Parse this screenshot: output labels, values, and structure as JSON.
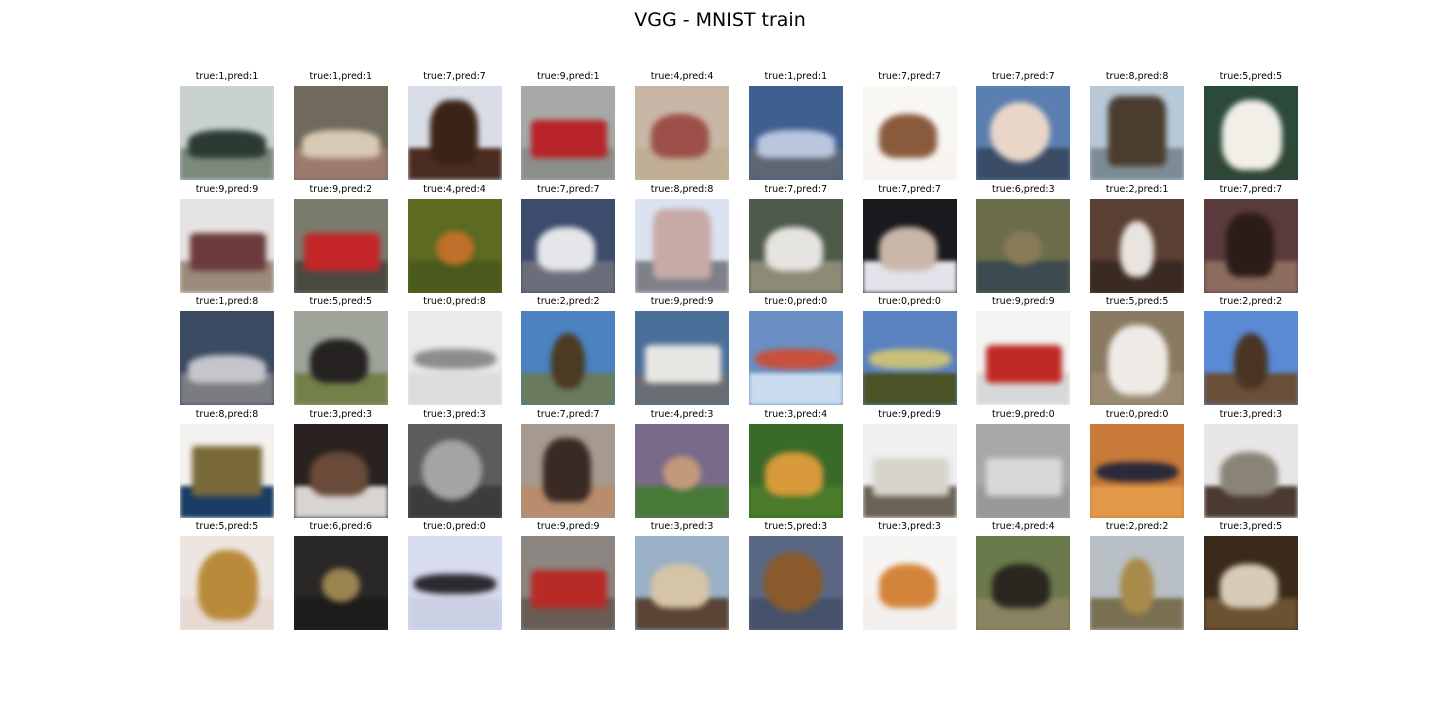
{
  "figure": {
    "title": "VGG - MNIST train"
  },
  "samples": [
    {
      "label": "true:1,pred:1",
      "content": "car",
      "bg": "#c9d2cf",
      "ground": "#7c8a7e",
      "subject": "#2c3a34",
      "shape": "car"
    },
    {
      "label": "true:1,pred:1",
      "content": "car",
      "bg": "#6f6a5c",
      "ground": "#9b7b6e",
      "subject": "#d8c9b4",
      "shape": "car"
    },
    {
      "label": "true:7,pred:7",
      "content": "horse",
      "bg": "#d9dde7",
      "ground": "#4a2c22",
      "subject": "#3a2417",
      "shape": "rider"
    },
    {
      "label": "true:9,pred:1",
      "content": "truck",
      "bg": "#a7a9a6",
      "ground": "#8b8f88",
      "subject": "#b8232a",
      "shape": "truck"
    },
    {
      "label": "true:4,pred:4",
      "content": "deer",
      "bg": "#c8b7a6",
      "ground": "#bfae93",
      "subject": "#9b4f48",
      "shape": "animal"
    },
    {
      "label": "true:1,pred:1",
      "content": "car",
      "bg": "#3e5f8f",
      "ground": "#5d6672",
      "subject": "#b9c6de",
      "shape": "car"
    },
    {
      "label": "true:7,pred:7",
      "content": "horse",
      "bg": "#f9f7f4",
      "ground": "#f7f3ef",
      "subject": "#8a5a3c",
      "shape": "animal"
    },
    {
      "label": "true:7,pred:7",
      "content": "horse",
      "bg": "#5b7fb0",
      "ground": "#3a4c66",
      "subject": "#e9d6c9",
      "shape": "head"
    },
    {
      "label": "true:8,pred:8",
      "content": "ship",
      "bg": "#b7c8d7",
      "ground": "#7d8b95",
      "subject": "#4a3c2e",
      "shape": "ship"
    },
    {
      "label": "true:5,pred:5",
      "content": "dog",
      "bg": "#2b4a3a",
      "ground": "#2f4636",
      "subject": "#f2efe9",
      "shape": "dog"
    },
    {
      "label": "true:9,pred:9",
      "content": "truck",
      "bg": "#e6e4e2",
      "ground": "#9a8b7c",
      "subject": "#6c3a3c",
      "shape": "truck"
    },
    {
      "label": "true:9,pred:2",
      "content": "truck",
      "bg": "#7a7b6c",
      "ground": "#4a4a42",
      "subject": "#c4262a",
      "shape": "truck"
    },
    {
      "label": "true:4,pred:4",
      "content": "deer",
      "bg": "#5c6a22",
      "ground": "#4a5a1c",
      "subject": "#c0702a",
      "shape": "small"
    },
    {
      "label": "true:7,pred:7",
      "content": "horse",
      "bg": "#3d4b6c",
      "ground": "#6b6e7a",
      "subject": "#e5e6ea",
      "shape": "animal"
    },
    {
      "label": "true:8,pred:8",
      "content": "ship",
      "bg": "#dbe3f1",
      "ground": "#7f8088",
      "subject": "#c7a9a6",
      "shape": "ship"
    },
    {
      "label": "true:7,pred:7",
      "content": "horse",
      "bg": "#4e5a4a",
      "ground": "#8d8a76",
      "subject": "#e6e4e0",
      "shape": "animal"
    },
    {
      "label": "true:7,pred:7",
      "content": "horse",
      "bg": "#1a1a1e",
      "ground": "#e4e2ea",
      "subject": "#cbb7aa",
      "shape": "animal"
    },
    {
      "label": "true:6,pred:3",
      "content": "frog",
      "bg": "#6c6d4a",
      "ground": "#3d4a50",
      "subject": "#8a7a5a",
      "shape": "small"
    },
    {
      "label": "true:2,pred:1",
      "content": "bird",
      "bg": "#5a4032",
      "ground": "#3a2a22",
      "subject": "#e9e4df",
      "shape": "bird"
    },
    {
      "label": "true:7,pred:7",
      "content": "horse",
      "bg": "#5a3b3e",
      "ground": "#8c6d60",
      "subject": "#2c1c18",
      "shape": "rider"
    },
    {
      "label": "true:1,pred:8",
      "content": "car",
      "bg": "#3c4a62",
      "ground": "#7a7c82",
      "subject": "#c4c6cc",
      "shape": "car"
    },
    {
      "label": "true:5,pred:5",
      "content": "dog",
      "bg": "#9ea49a",
      "ground": "#72814a",
      "subject": "#252221",
      "shape": "animal"
    },
    {
      "label": "true:0,pred:8",
      "content": "airplane",
      "bg": "#eaeaea",
      "ground": "#dcdcdc",
      "subject": "#8c8c8c",
      "shape": "plane"
    },
    {
      "label": "true:2,pred:2",
      "content": "bird",
      "bg": "#4a82c2",
      "ground": "#6a7a5a",
      "subject": "#4c3a22",
      "shape": "bird"
    },
    {
      "label": "true:9,pred:9",
      "content": "truck",
      "bg": "#4a6f99",
      "ground": "#6a6e74",
      "subject": "#e8e6e2",
      "shape": "truck"
    },
    {
      "label": "true:0,pred:0",
      "content": "airplane",
      "bg": "#6a8fc4",
      "ground": "#c9dcef",
      "subject": "#c8503c",
      "shape": "plane"
    },
    {
      "label": "true:0,pred:0",
      "content": "airplane",
      "bg": "#5a82c0",
      "ground": "#4a5226",
      "subject": "#c8c07a",
      "shape": "plane"
    },
    {
      "label": "true:9,pred:9",
      "content": "truck",
      "bg": "#f4f4f4",
      "ground": "#d8d8d8",
      "subject": "#c02a26",
      "shape": "truck"
    },
    {
      "label": "true:5,pred:5",
      "content": "dog",
      "bg": "#8a7a62",
      "ground": "#9a8a72",
      "subject": "#eeeae6",
      "shape": "dog"
    },
    {
      "label": "true:2,pred:2",
      "content": "bird",
      "bg": "#5a8ad4",
      "ground": "#6a5038",
      "subject": "#4a3424",
      "shape": "bird"
    },
    {
      "label": "true:8,pred:8",
      "content": "ship",
      "bg": "#f4f2ee",
      "ground": "#1a3c66",
      "subject": "#7a6a3a",
      "shape": "framed"
    },
    {
      "label": "true:3,pred:3",
      "content": "cat",
      "bg": "#2a2220",
      "ground": "#d8d4d0",
      "subject": "#6a4a38",
      "shape": "animal"
    },
    {
      "label": "true:3,pred:3",
      "content": "cat",
      "bg": "#5c5c5c",
      "ground": "#3c3c3c",
      "subject": "#a4a4a4",
      "shape": "head"
    },
    {
      "label": "true:7,pred:7",
      "content": "horse",
      "bg": "#a69a90",
      "ground": "#b88c6c",
      "subject": "#3a2a24",
      "shape": "rider"
    },
    {
      "label": "true:4,pred:3",
      "content": "deer",
      "bg": "#7a6a8a",
      "ground": "#4a7a3a",
      "subject": "#c29a7a",
      "shape": "small"
    },
    {
      "label": "true:3,pred:4",
      "content": "cat",
      "bg": "#3a6a2a",
      "ground": "#4a7a2a",
      "subject": "#d89a3a",
      "shape": "animal"
    },
    {
      "label": "true:9,pred:9",
      "content": "truck",
      "bg": "#f0f0f2",
      "ground": "#6a6256",
      "subject": "#d8d4cc",
      "shape": "truck"
    },
    {
      "label": "true:9,pred:0",
      "content": "truck",
      "bg": "#a8a8a8",
      "ground": "#989898",
      "subject": "#d8d8d8",
      "shape": "truck"
    },
    {
      "label": "true:0,pred:0",
      "content": "airplane",
      "bg": "#c87a3a",
      "ground": "#e29a4a",
      "subject": "#2a2a3a",
      "shape": "plane"
    },
    {
      "label": "true:3,pred:3",
      "content": "cat",
      "bg": "#e8e6e6",
      "ground": "#4a3a32",
      "subject": "#8a8478",
      "shape": "animal"
    },
    {
      "label": "true:5,pred:5",
      "content": "dog",
      "bg": "#ede6e0",
      "ground": "#e8d8d4",
      "subject": "#b88a3a",
      "shape": "dog"
    },
    {
      "label": "true:6,pred:6",
      "content": "frog",
      "bg": "#2a2826",
      "ground": "#1e1c1a",
      "subject": "#9a8450",
      "shape": "small"
    },
    {
      "label": "true:0,pred:0",
      "content": "airplane",
      "bg": "#d8dcef",
      "ground": "#ccd0e4",
      "subject": "#2a2a30",
      "shape": "plane"
    },
    {
      "label": "true:9,pred:9",
      "content": "truck",
      "bg": "#8c8682",
      "ground": "#6a5c52",
      "subject": "#b82a26",
      "shape": "truck"
    },
    {
      "label": "true:3,pred:3",
      "content": "cat",
      "bg": "#9ab0c6",
      "ground": "#5a4434",
      "subject": "#d6c4a6",
      "shape": "animal"
    },
    {
      "label": "true:5,pred:3",
      "content": "dog",
      "bg": "#5a6886",
      "ground": "#46526a",
      "subject": "#8a5a2c",
      "shape": "head"
    },
    {
      "label": "true:3,pred:3",
      "content": "cat",
      "bg": "#f6f4f2",
      "ground": "#f2efec",
      "subject": "#d4843a",
      "shape": "animal"
    },
    {
      "label": "true:4,pred:4",
      "content": "deer",
      "bg": "#6a7a4a",
      "ground": "#8a8462",
      "subject": "#2a2620",
      "shape": "animal"
    },
    {
      "label": "true:2,pred:2",
      "content": "bird",
      "bg": "#b8c0c6",
      "ground": "#7a7052",
      "subject": "#a88a4a",
      "shape": "bird"
    },
    {
      "label": "true:3,pred:5",
      "content": "cat",
      "bg": "#3a2a1a",
      "ground": "#6a5232",
      "subject": "#d8ccb8",
      "shape": "animal"
    }
  ]
}
